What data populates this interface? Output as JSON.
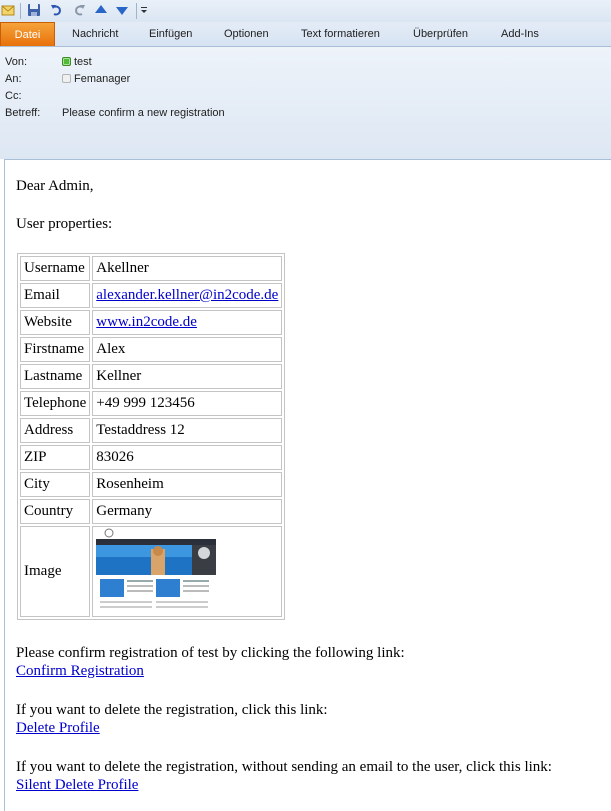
{
  "ribbon": {
    "tabs": [
      "Datei",
      "Nachricht",
      "Einfügen",
      "Optionen",
      "Text formatieren",
      "Überprüfen",
      "Add-Ins"
    ]
  },
  "header": {
    "from_label": "Von:",
    "from_value": "test",
    "to_label": "An:",
    "to_value": "Femanager",
    "cc_label": "Cc:",
    "cc_value": "",
    "subject_label": "Betreff:",
    "subject_value": "Please confirm a new registration"
  },
  "body": {
    "greeting": "Dear Admin,",
    "intro": "User properties:",
    "properties": [
      {
        "key": "Username",
        "value": "Akellner",
        "link": false
      },
      {
        "key": "Email",
        "value": "alexander.kellner@in2code.de",
        "link": true
      },
      {
        "key": "Website",
        "value": "www.in2code.de",
        "link": true
      },
      {
        "key": "Firstname",
        "value": "Alex",
        "link": false
      },
      {
        "key": "Lastname",
        "value": "Kellner",
        "link": false
      },
      {
        "key": "Telephone",
        "value": "+49 999 123456",
        "link": false
      },
      {
        "key": "Address",
        "value": "Testaddress 12",
        "link": false
      },
      {
        "key": "ZIP",
        "value": "83026",
        "link": false
      },
      {
        "key": "City",
        "value": "Rosenheim",
        "link": false
      },
      {
        "key": "Country",
        "value": "Germany",
        "link": false
      }
    ],
    "image_label": "Image",
    "confirm_text": "Please confirm registration of test by clicking the following link:",
    "confirm_link": "Confirm Registration",
    "delete_text": "If you want to delete the registration, click this link:",
    "delete_link": "Delete Profile",
    "silent_text": "If you want to delete the registration, without sending an email to the user, click this link:",
    "silent_link": "Silent Delete Profile"
  },
  "colors": {
    "file_tab": "#e8710b",
    "link": "#0000cc",
    "ribbon_bg": "#dde7f3"
  }
}
